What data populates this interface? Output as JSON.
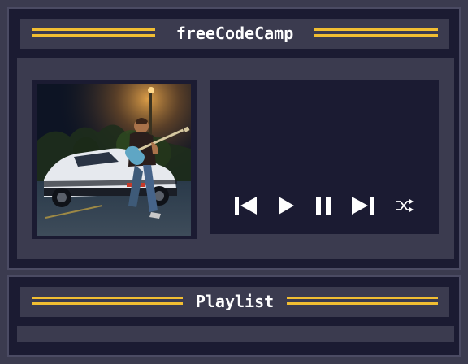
{
  "player": {
    "title": "freeCodeCamp",
    "accent_color": "#f1be32",
    "album_art": {
      "icon": "album-cover-image"
    },
    "controls": [
      {
        "name": "previous-button",
        "icon": "skip-back-icon"
      },
      {
        "name": "play-button",
        "icon": "play-icon"
      },
      {
        "name": "pause-button",
        "icon": "pause-icon"
      },
      {
        "name": "next-button",
        "icon": "skip-forward-icon"
      },
      {
        "name": "shuffle-button",
        "icon": "shuffle-icon"
      }
    ]
  },
  "playlist": {
    "title": "Playlist"
  }
}
